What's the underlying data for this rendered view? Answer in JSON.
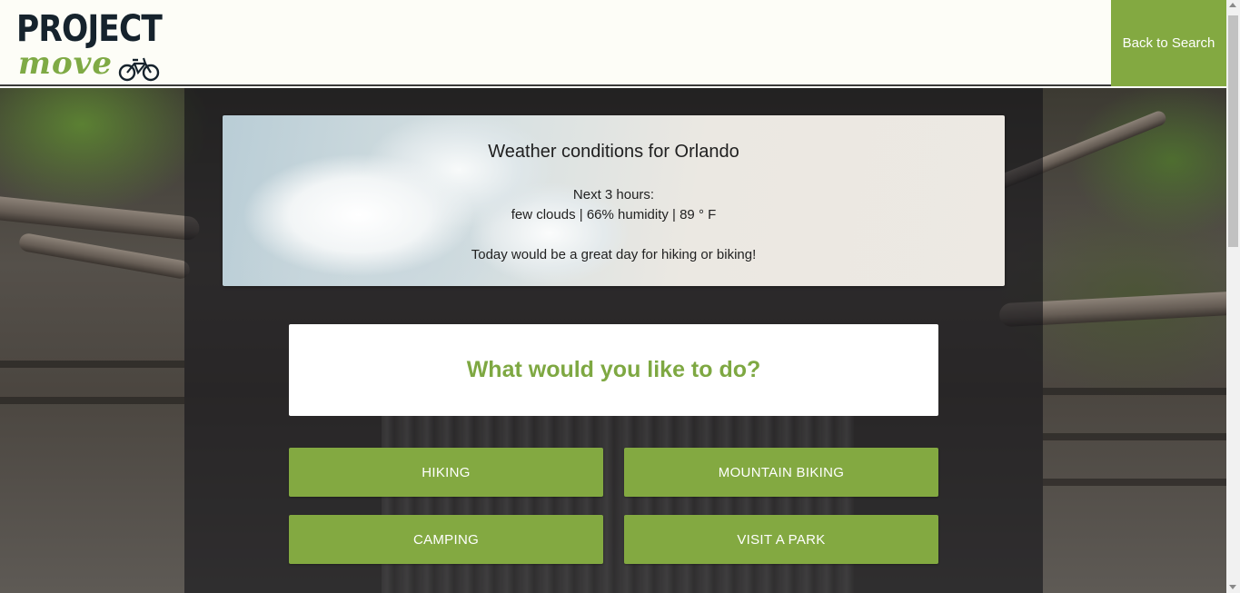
{
  "header": {
    "logo_line1": "PROJECT",
    "logo_line2": "move",
    "back_button_label": "Back to Search"
  },
  "weather": {
    "title": "Weather conditions for Orlando",
    "forecast_label": "Next 3 hours:",
    "conditions": "few clouds | 66% humidity | 89 ° F",
    "advice": "Today would be a great day for hiking or biking!"
  },
  "prompt": {
    "question": "What would you like to do?"
  },
  "activities": [
    {
      "label": "HIKING"
    },
    {
      "label": "MOUNTAIN BIKING"
    },
    {
      "label": "CAMPING"
    },
    {
      "label": "VISIT A PARK"
    }
  ],
  "colors": {
    "brand_green": "#83a941",
    "header_bg": "#fdfdf7",
    "logo_dark": "#16232d"
  },
  "icons": {
    "logo_bike": "bicycle-icon"
  }
}
